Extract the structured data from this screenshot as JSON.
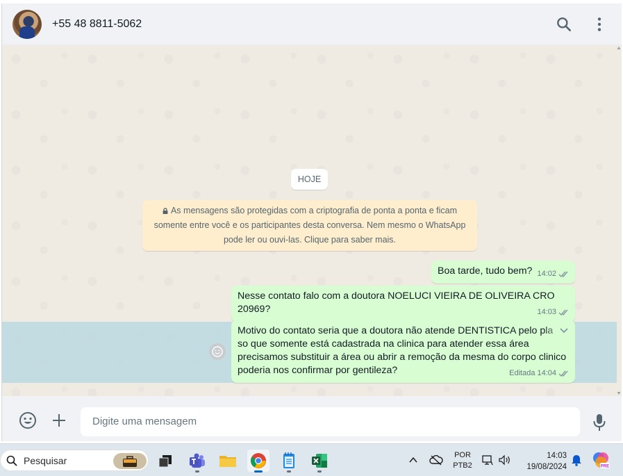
{
  "header": {
    "contact_name": "+55 48 8811-5062"
  },
  "chat": {
    "date_chip": "HOJE",
    "encryption_lines": [
      "As mensagens são protegidas com a criptografia de ponta a ponta e ficam",
      "somente entre você e os participantes desta conversa. Nem mesmo o WhatsApp",
      "pode ler ou ouvi-las. Clique para saber mais."
    ],
    "messages": [
      {
        "lines": [
          "Boa tarde, tudo bem?"
        ],
        "time": "14:02",
        "edited": ""
      },
      {
        "lines": [
          "Nesse contato falo com a doutora NOELUCI VIEIRA DE OLIVEIRA  CRO",
          "20969?"
        ],
        "time": "14:03",
        "edited": ""
      },
      {
        "lines": [
          "Motivo do contato seria que a doutora não atende DENTISTICA pelo pla",
          "so que somente está cadastrada na clinica para atender essa área",
          "precisamos substituir a área ou abrir a remoção da mesma do corpo clinico",
          "poderia nos confirmar por gentileza?"
        ],
        "time": "14:04",
        "edited": "Editada"
      }
    ]
  },
  "composer": {
    "placeholder": "Digite uma mensagem"
  },
  "taskbar": {
    "search_label": "Pesquisar",
    "lang_top": "POR",
    "lang_bottom": "PTB2",
    "time": "14:03",
    "date": "19/08/2024",
    "apps": [
      "task-view",
      "teams",
      "file-explorer",
      "chrome",
      "notepad",
      "excel"
    ]
  },
  "colors": {
    "bubble_out": "#d9fdd3",
    "system_notice": "#ffeecd",
    "chat_bg": "#efeae2",
    "tick": "#8696a0"
  }
}
